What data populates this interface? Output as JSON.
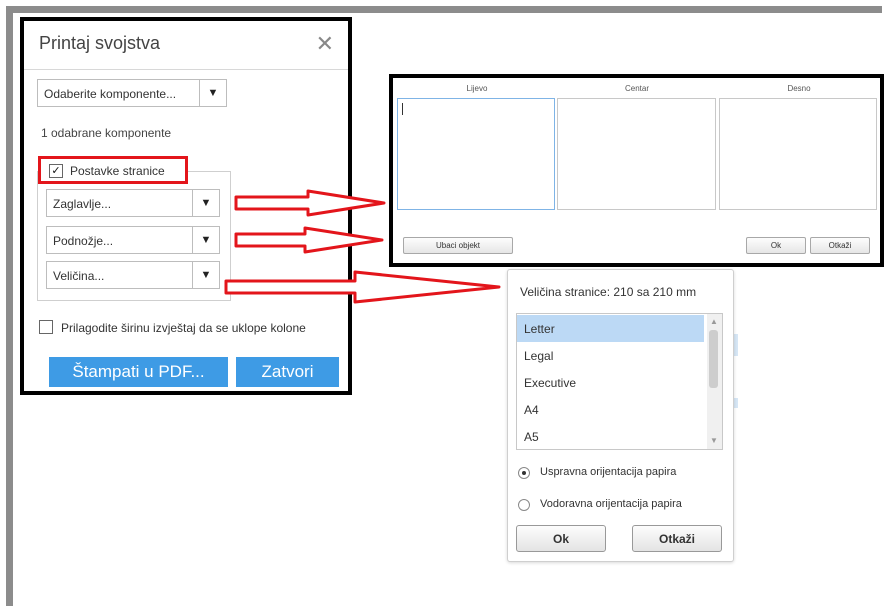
{
  "dialog": {
    "title": "Printaj svojstva",
    "close_icon": "close-icon",
    "component_select": "Odaberite komponente...",
    "selected_count": "1 odabrane komponente",
    "page_settings_label": "Postavke stranice",
    "page_settings_checked": true,
    "header_select": "Zaglavlje...",
    "footer_select": "Podnožje...",
    "size_select": "Veličina...",
    "fit_width_label": "Prilagodite širinu izvještaj da se uklope kolone",
    "fit_width_checked": false,
    "print_pdf_button": "Štampati u PDF...",
    "close_button": "Zatvori",
    "accent_color": "#3e9be5",
    "highlight_color": "#e3151b"
  },
  "header_footer_panel": {
    "columns": [
      "Lijevo",
      "Centar",
      "Desno"
    ],
    "insert_object_button": "Ubaci objekt",
    "ok_button": "Ok",
    "cancel_button": "Otkaži"
  },
  "page_size_panel": {
    "title": "Veličina stranice: 210 sa 210 mm",
    "sizes": [
      "Letter",
      "Legal",
      "Executive",
      "A4",
      "A5"
    ],
    "selected_size": "Letter",
    "orientation_portrait": "Uspravna orijentacija papira",
    "orientation_landscape": "Vodoravna orijentacija papira",
    "selected_orientation": "portrait",
    "ok_button": "Ok",
    "cancel_button": "Otkaži"
  }
}
